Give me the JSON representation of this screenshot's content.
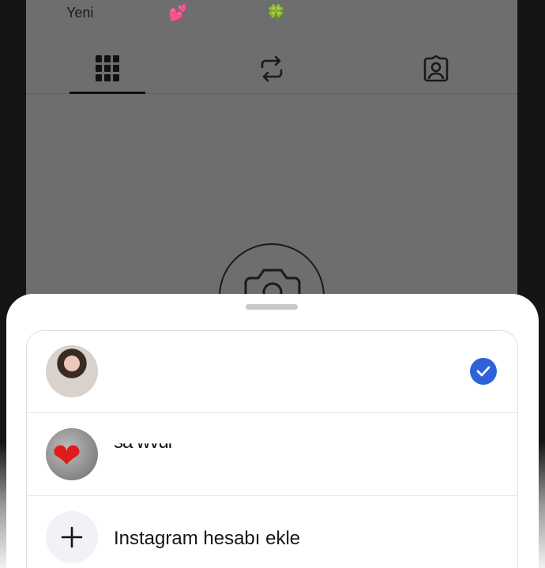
{
  "background_profile": {
    "highlights": {
      "label": "Yeni",
      "emojis": [
        "💕",
        "🍀"
      ]
    },
    "tabs": [
      {
        "icon": "grid-icon",
        "active": true
      },
      {
        "icon": "reels-repost-icon",
        "active": false
      },
      {
        "icon": "tagged-icon",
        "active": false
      }
    ]
  },
  "account_sheet": {
    "accounts": [
      {
        "username": "",
        "selected": true
      },
      {
        "username": "sa    wvul",
        "selected": false
      }
    ],
    "add_account_label": "Instagram hesabı ekle"
  },
  "colors": {
    "accent": "#2d62d8",
    "dimmed_background": "#6e6e6e"
  }
}
